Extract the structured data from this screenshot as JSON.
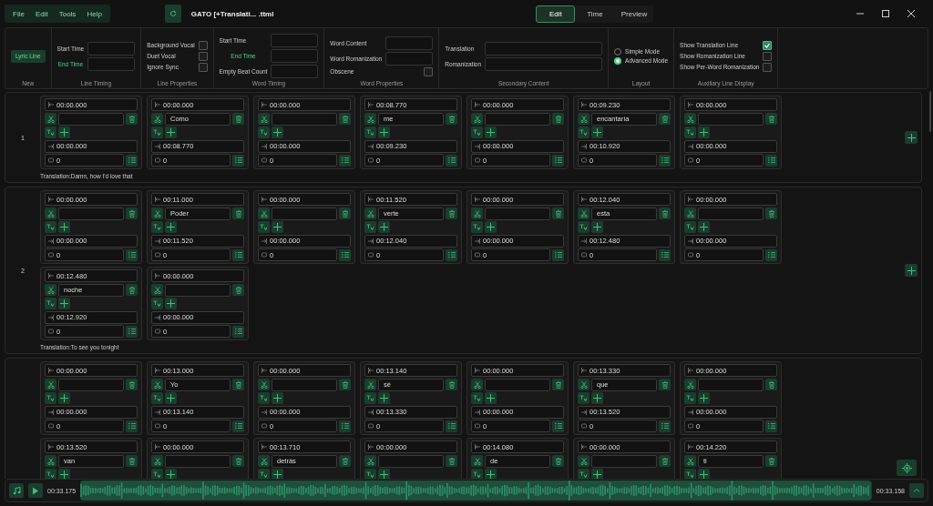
{
  "menu": [
    "File",
    "Edit",
    "Tools",
    "Help"
  ],
  "file_title": "GATO [+Translati... .ttml",
  "tabs": [
    {
      "label": "Edit",
      "selected": true
    },
    {
      "label": "Time",
      "selected": false
    },
    {
      "label": "Preview",
      "selected": false
    }
  ],
  "ribbon": [
    {
      "title": "New",
      "items": [
        {
          "kind": "button",
          "label": "Lyric Line"
        }
      ]
    },
    {
      "title": "Line Timing",
      "items": [
        {
          "kind": "field",
          "label": "Start Time",
          "accent": false
        },
        {
          "kind": "field",
          "label": "End Time",
          "accent": true
        }
      ]
    },
    {
      "title": "Line Properties",
      "items": [
        {
          "kind": "check",
          "label": "Background Vocal",
          "checked": false
        },
        {
          "kind": "check",
          "label": "Duet Vocal",
          "checked": false
        },
        {
          "kind": "check",
          "label": "Ignore Sync",
          "checked": false
        }
      ]
    },
    {
      "title": "Word Timing",
      "items": [
        {
          "kind": "field",
          "label": "Start Time",
          "accent": false
        },
        {
          "kind": "field",
          "label": "End Time",
          "accent": true
        },
        {
          "kind": "field",
          "label": "Empty Beat Count",
          "accent": false
        }
      ]
    },
    {
      "title": "Word Properties",
      "items": [
        {
          "kind": "field",
          "label": "Word Content",
          "accent": false
        },
        {
          "kind": "field",
          "label": "Word Romanization",
          "accent": false
        },
        {
          "kind": "check",
          "label": "Obscene",
          "checked": false
        }
      ]
    },
    {
      "title": "Secondary Content",
      "items": [
        {
          "kind": "wide-field",
          "label": "Translation",
          "accent": false
        },
        {
          "kind": "wide-field",
          "label": "Romanization",
          "accent": false
        }
      ]
    },
    {
      "title": "Layout",
      "items": [
        {
          "kind": "radio",
          "label": "Simple Mode",
          "selected": false
        },
        {
          "kind": "radio",
          "label": "Advanced Mode",
          "selected": true
        }
      ]
    },
    {
      "title": "Auxiliary Line Display",
      "items": [
        {
          "kind": "check",
          "label": "Show Translation Line",
          "checked": true
        },
        {
          "kind": "check",
          "label": "Show Romanization Line",
          "checked": false
        },
        {
          "kind": "check",
          "label": "Show Per-Word Romanization",
          "checked": false
        }
      ]
    }
  ],
  "lines": [
    {
      "number": "1",
      "translation_label": "Translation:",
      "translation": "Damn, how I'd love that",
      "words": [
        {
          "start": "00:00.000",
          "end": "00:00.000",
          "beats": "0"
        },
        {
          "start": "00:00.000",
          "text": "Como",
          "end": "00:08.770",
          "beats": "0"
        },
        {
          "start": "00:00.000",
          "end": "00:00.000",
          "beats": "0"
        },
        {
          "start": "00:08.770",
          "text": "me",
          "end": "00:09.230",
          "beats": "0"
        },
        {
          "start": "00:00.000",
          "end": "00:00.000",
          "beats": "0"
        },
        {
          "start": "00:09.230",
          "text": "encantaría",
          "end": "00:10.920",
          "beats": "0"
        },
        {
          "start": "00:00.000",
          "end": "00:00.000",
          "beats": "0"
        }
      ]
    },
    {
      "number": "2",
      "translation_label": "Translation:",
      "translation": "To see you tonight",
      "words": [
        {
          "start": "00:00.000",
          "end": "00:00.000",
          "beats": "0"
        },
        {
          "start": "00:11.000",
          "text": "Poder",
          "end": "00:11.520",
          "beats": "0"
        },
        {
          "start": "00:00.000",
          "end": "00:00.000",
          "beats": "0"
        },
        {
          "start": "00:11.520",
          "text": "verte",
          "end": "00:12.040",
          "beats": "0"
        },
        {
          "start": "00:00.000",
          "end": "00:00.000",
          "beats": "0"
        },
        {
          "start": "00:12.040",
          "text": "esta",
          "end": "00:12.480",
          "beats": "0"
        },
        {
          "start": "00:00.000",
          "end": "00:00.000",
          "beats": "0"
        },
        {
          "start": "00:12.480",
          "text": "noche",
          "end": "00:12.920",
          "beats": "0"
        },
        {
          "start": "00:00.000",
          "end": "00:00.000",
          "beats": "0"
        }
      ]
    },
    {
      "words": [
        {
          "start": "00:00.000",
          "end": "00:00.000",
          "beats": "0"
        },
        {
          "start": "00:13.000",
          "text": "Yo",
          "end": "00:13.140",
          "beats": "0"
        },
        {
          "start": "00:00.000",
          "end": "00:00.000",
          "beats": "0"
        },
        {
          "start": "00:13.140",
          "text": "sé",
          "end": "00:13.330",
          "beats": "0"
        },
        {
          "start": "00:00.000",
          "end": "00:00.000",
          "beats": "0"
        },
        {
          "start": "00:13.330",
          "text": "que",
          "end": "00:13.520",
          "beats": "0"
        },
        {
          "start": "00:00.000",
          "end": "00:00.000",
          "beats": "0"
        },
        {
          "start": "00:13.520",
          "text": "van"
        },
        {
          "start": "00:00.000"
        },
        {
          "start": "00:13.710",
          "text": "detrás"
        },
        {
          "start": "00:00.000"
        },
        {
          "start": "00:14.080",
          "text": "de"
        },
        {
          "start": "00:00.000"
        },
        {
          "start": "00:14.220",
          "text": "ti"
        }
      ]
    }
  ],
  "player": {
    "current": "00:33.175",
    "total": "00:33.158"
  }
}
